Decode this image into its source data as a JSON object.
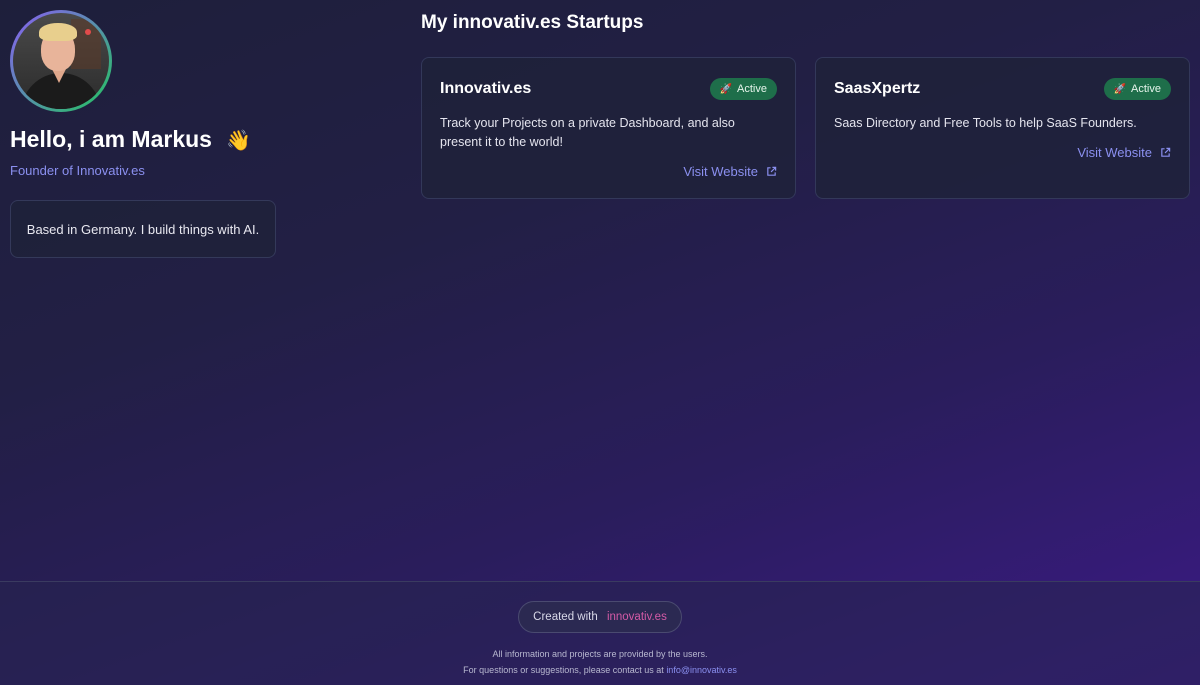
{
  "profile": {
    "greeting": "Hello, i am Markus",
    "wave_emoji": "👋",
    "subtitle": "Founder of Innovativ.es",
    "bio": "Based in Germany. I build things with AI."
  },
  "startups": {
    "section_title": "My innovativ.es Startups",
    "items": [
      {
        "name": "Innovativ.es",
        "status": "Active",
        "status_icon": "rocket-icon",
        "description": "Track your Projects on a private Dashboard, and also present it to the world!",
        "link_label": "Visit Website",
        "link_icon": "external-link-icon"
      },
      {
        "name": "SaasXpertz",
        "status": "Active",
        "status_icon": "rocket-icon",
        "description": "Saas Directory and Free Tools to help SaaS Founders.",
        "link_label": "Visit Website",
        "link_icon": "external-link-icon"
      }
    ]
  },
  "footer": {
    "created_with": "Created with",
    "brand": "innovativ.es",
    "line1": "All information and projects are provided by the users.",
    "line2_prefix": "For questions or suggestions, please contact us at",
    "email": "info@innovativ.es"
  },
  "colors": {
    "accent": "#8b90f0",
    "badge_bg": "#1e6e4a",
    "brand_pink": "#d45aa6"
  }
}
